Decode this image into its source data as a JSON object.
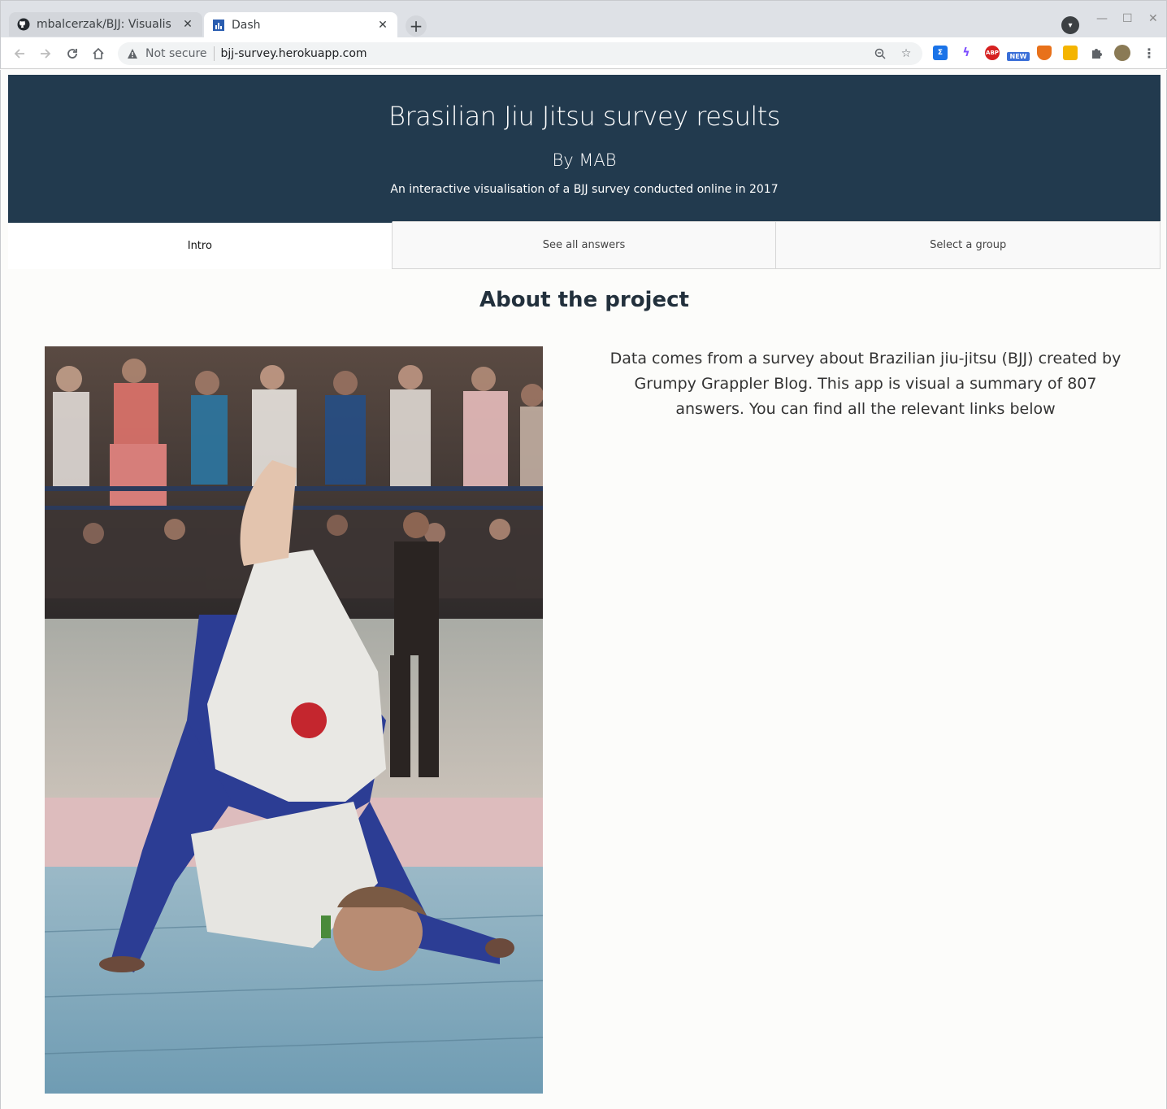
{
  "browser": {
    "tabs": [
      {
        "title": "mbalcerzak/BJJ: Visualis",
        "favicon": "github-icon",
        "active": false
      },
      {
        "title": "Dash",
        "favicon": "dash-chart-icon",
        "active": true
      }
    ],
    "address_bar": {
      "security_label": "Not secure",
      "url": "bjj-survey.herokuapp.com"
    },
    "extensions": [
      {
        "name": "sigma-extension-icon",
        "color": "#1a73e8"
      },
      {
        "name": "bolt-extension-icon",
        "color": "#7c4dff"
      },
      {
        "name": "adblock-plus-icon",
        "color": "#d62121",
        "text": "ABP"
      },
      {
        "name": "new-badge-extension-icon",
        "color": "#3a6fd8",
        "text": "NEW"
      },
      {
        "name": "shield-extension-icon",
        "color": "#e8711a"
      },
      {
        "name": "flag-extension-icon",
        "color": "#f4b400"
      },
      {
        "name": "puzzle-icon",
        "color": "#5f6368"
      }
    ]
  },
  "header": {
    "title": "Brasilian Jiu Jitsu survey results",
    "author": "By MAB",
    "subtitle": "An interactive visualisation of a BJJ survey conducted online in 2017",
    "background": "#223a4e"
  },
  "tabs": [
    {
      "label": "Intro",
      "selected": true
    },
    {
      "label": "See all answers",
      "selected": false
    },
    {
      "label": "Select a group",
      "selected": false
    }
  ],
  "intro": {
    "heading": "About the project",
    "description": "Data comes from a survey about Brazilian jiu-jitsu (BJJ) created by Grumpy Grappler Blog. This app is visual a summary of 807 answers. You can find all the relevant links below"
  }
}
